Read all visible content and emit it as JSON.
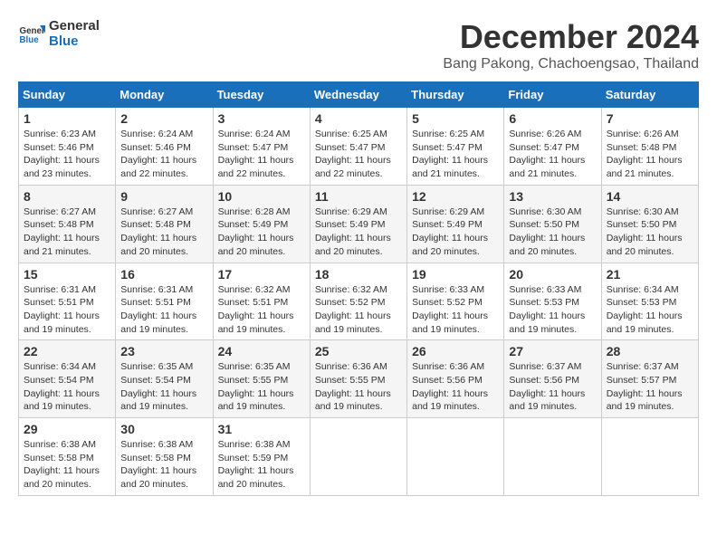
{
  "logo": {
    "line1": "General",
    "line2": "Blue"
  },
  "title": "December 2024",
  "location": "Bang Pakong, Chachoengsao, Thailand",
  "weekdays": [
    "Sunday",
    "Monday",
    "Tuesday",
    "Wednesday",
    "Thursday",
    "Friday",
    "Saturday"
  ],
  "weeks": [
    [
      {
        "day": "1",
        "info": "Sunrise: 6:23 AM\nSunset: 5:46 PM\nDaylight: 11 hours\nand 23 minutes."
      },
      {
        "day": "2",
        "info": "Sunrise: 6:24 AM\nSunset: 5:46 PM\nDaylight: 11 hours\nand 22 minutes."
      },
      {
        "day": "3",
        "info": "Sunrise: 6:24 AM\nSunset: 5:47 PM\nDaylight: 11 hours\nand 22 minutes."
      },
      {
        "day": "4",
        "info": "Sunrise: 6:25 AM\nSunset: 5:47 PM\nDaylight: 11 hours\nand 22 minutes."
      },
      {
        "day": "5",
        "info": "Sunrise: 6:25 AM\nSunset: 5:47 PM\nDaylight: 11 hours\nand 21 minutes."
      },
      {
        "day": "6",
        "info": "Sunrise: 6:26 AM\nSunset: 5:47 PM\nDaylight: 11 hours\nand 21 minutes."
      },
      {
        "day": "7",
        "info": "Sunrise: 6:26 AM\nSunset: 5:48 PM\nDaylight: 11 hours\nand 21 minutes."
      }
    ],
    [
      {
        "day": "8",
        "info": "Sunrise: 6:27 AM\nSunset: 5:48 PM\nDaylight: 11 hours\nand 21 minutes."
      },
      {
        "day": "9",
        "info": "Sunrise: 6:27 AM\nSunset: 5:48 PM\nDaylight: 11 hours\nand 20 minutes."
      },
      {
        "day": "10",
        "info": "Sunrise: 6:28 AM\nSunset: 5:49 PM\nDaylight: 11 hours\nand 20 minutes."
      },
      {
        "day": "11",
        "info": "Sunrise: 6:29 AM\nSunset: 5:49 PM\nDaylight: 11 hours\nand 20 minutes."
      },
      {
        "day": "12",
        "info": "Sunrise: 6:29 AM\nSunset: 5:49 PM\nDaylight: 11 hours\nand 20 minutes."
      },
      {
        "day": "13",
        "info": "Sunrise: 6:30 AM\nSunset: 5:50 PM\nDaylight: 11 hours\nand 20 minutes."
      },
      {
        "day": "14",
        "info": "Sunrise: 6:30 AM\nSunset: 5:50 PM\nDaylight: 11 hours\nand 20 minutes."
      }
    ],
    [
      {
        "day": "15",
        "info": "Sunrise: 6:31 AM\nSunset: 5:51 PM\nDaylight: 11 hours\nand 19 minutes."
      },
      {
        "day": "16",
        "info": "Sunrise: 6:31 AM\nSunset: 5:51 PM\nDaylight: 11 hours\nand 19 minutes."
      },
      {
        "day": "17",
        "info": "Sunrise: 6:32 AM\nSunset: 5:51 PM\nDaylight: 11 hours\nand 19 minutes."
      },
      {
        "day": "18",
        "info": "Sunrise: 6:32 AM\nSunset: 5:52 PM\nDaylight: 11 hours\nand 19 minutes."
      },
      {
        "day": "19",
        "info": "Sunrise: 6:33 AM\nSunset: 5:52 PM\nDaylight: 11 hours\nand 19 minutes."
      },
      {
        "day": "20",
        "info": "Sunrise: 6:33 AM\nSunset: 5:53 PM\nDaylight: 11 hours\nand 19 minutes."
      },
      {
        "day": "21",
        "info": "Sunrise: 6:34 AM\nSunset: 5:53 PM\nDaylight: 11 hours\nand 19 minutes."
      }
    ],
    [
      {
        "day": "22",
        "info": "Sunrise: 6:34 AM\nSunset: 5:54 PM\nDaylight: 11 hours\nand 19 minutes."
      },
      {
        "day": "23",
        "info": "Sunrise: 6:35 AM\nSunset: 5:54 PM\nDaylight: 11 hours\nand 19 minutes."
      },
      {
        "day": "24",
        "info": "Sunrise: 6:35 AM\nSunset: 5:55 PM\nDaylight: 11 hours\nand 19 minutes."
      },
      {
        "day": "25",
        "info": "Sunrise: 6:36 AM\nSunset: 5:55 PM\nDaylight: 11 hours\nand 19 minutes."
      },
      {
        "day": "26",
        "info": "Sunrise: 6:36 AM\nSunset: 5:56 PM\nDaylight: 11 hours\nand 19 minutes."
      },
      {
        "day": "27",
        "info": "Sunrise: 6:37 AM\nSunset: 5:56 PM\nDaylight: 11 hours\nand 19 minutes."
      },
      {
        "day": "28",
        "info": "Sunrise: 6:37 AM\nSunset: 5:57 PM\nDaylight: 11 hours\nand 19 minutes."
      }
    ],
    [
      {
        "day": "29",
        "info": "Sunrise: 6:38 AM\nSunset: 5:58 PM\nDaylight: 11 hours\nand 20 minutes."
      },
      {
        "day": "30",
        "info": "Sunrise: 6:38 AM\nSunset: 5:58 PM\nDaylight: 11 hours\nand 20 minutes."
      },
      {
        "day": "31",
        "info": "Sunrise: 6:38 AM\nSunset: 5:59 PM\nDaylight: 11 hours\nand 20 minutes."
      },
      null,
      null,
      null,
      null
    ]
  ]
}
